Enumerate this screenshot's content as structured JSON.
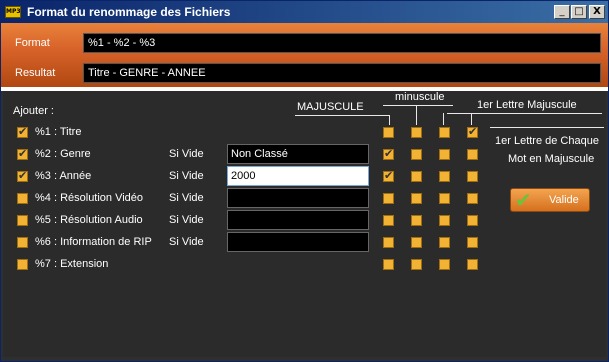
{
  "window": {
    "title": "Format du renommage des Fichiers",
    "icon_text": "MP3"
  },
  "controls": {
    "minimize": "_",
    "maximize": "□",
    "close": "X"
  },
  "header": {
    "format_label": "Format",
    "format_value": "%1 - %2 - %3",
    "result_label": "Resultat",
    "result_value": "Titre - GENRE - ANNEE"
  },
  "section": {
    "add_label": "Ajouter :"
  },
  "columns": {
    "upper": "MAJUSCULE",
    "lower": "minuscule",
    "first": "1er Lettre Majuscule"
  },
  "rows": [
    {
      "label": "%1 : Titre",
      "checked": true,
      "has_field": false,
      "field_label": "",
      "field_value": "",
      "case": [
        false,
        false,
        false,
        true
      ]
    },
    {
      "label": "%2 : Genre",
      "checked": true,
      "has_field": true,
      "field_label": "Si Vide",
      "field_value": "Non Classé",
      "case": [
        true,
        false,
        false,
        false
      ]
    },
    {
      "label": "%3 : Année",
      "checked": true,
      "has_field": true,
      "field_label": "Si Vide",
      "field_value": "2000",
      "case": [
        true,
        false,
        false,
        false
      ]
    },
    {
      "label": "%4 : Résolution Vidéo",
      "checked": false,
      "has_field": true,
      "field_label": "Si Vide",
      "field_value": "",
      "case": [
        false,
        false,
        false,
        false
      ]
    },
    {
      "label": "%5 : Résolution Audio",
      "checked": false,
      "has_field": true,
      "field_label": "Si Vide",
      "field_value": "",
      "case": [
        false,
        false,
        false,
        false
      ]
    },
    {
      "label": "%6 : Information de RIP",
      "checked": false,
      "has_field": true,
      "field_label": "Si Vide",
      "field_value": "",
      "case": [
        false,
        false,
        false,
        false
      ]
    },
    {
      "label": "%7 : Extension",
      "checked": false,
      "has_field": false,
      "field_label": "",
      "field_value": "",
      "case": [
        false,
        false,
        false,
        false
      ]
    }
  ],
  "side_panel": {
    "line1": "1er Lettre de Chaque",
    "line2": "Mot en Majuscule"
  },
  "buttons": {
    "valide": "Valide"
  },
  "colors": {
    "title_bar": "#0a246a",
    "header_orange": "#d8632a",
    "checkbox": "#f2b233",
    "body_bg": "#2b2b2b"
  }
}
